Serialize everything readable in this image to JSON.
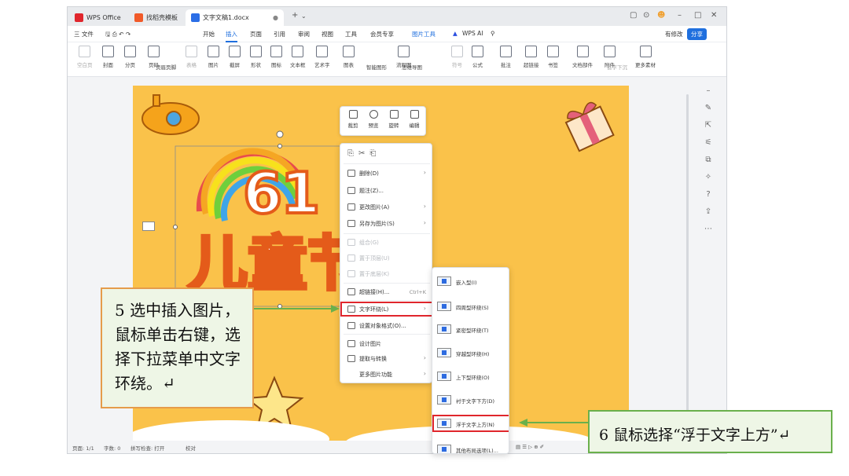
{
  "tabs": [
    {
      "label": "WPS Office"
    },
    {
      "label": "找稻壳模板"
    },
    {
      "label": "文字文稿1.docx"
    }
  ],
  "window": {
    "new_tab": "+",
    "dropdown": "⌄"
  },
  "menubar": {
    "file": "三 文件",
    "items": [
      "开始",
      "插入",
      "页面",
      "引用",
      "审阅",
      "视图",
      "工具",
      "会员专享",
      "图片工具"
    ],
    "wps_ai": "WPS AI",
    "revise": "有修改",
    "share": "分享"
  },
  "ribbon": [
    "空白页",
    "封面",
    "分页",
    "页码",
    "页眉页脚",
    "表格",
    "图片",
    "截屏",
    "形状",
    "图标",
    "文本框",
    "艺术字",
    "图表",
    "流程图",
    "智能图形",
    "思维导图",
    "符号",
    "公式",
    "批注",
    "超链接",
    "书签",
    "文档部件",
    "附件",
    "首字下沉",
    "更多素材"
  ],
  "doc": {
    "art_text_1": "61",
    "art_text_2": "儿童节"
  },
  "mini_toolbar": [
    "裁剪",
    "预览",
    "旋转",
    "编辑"
  ],
  "context_menu": {
    "delete": "删除(D)",
    "caption": "题注(Z)...",
    "change_picture": "更改图片(A)",
    "save_as_picture": "另存为图片(S)",
    "group": "组合(G)",
    "bring_front": "置于顶层(U)",
    "send_back": "置于底层(K)",
    "hyperlink": "超链接(H)...",
    "hyperlink_shortcut": "Ctrl+K",
    "text_wrap": "文字环绕(L)",
    "format_object": "设置对象格式(O)...",
    "design_picture": "设计图片",
    "extract_convert": "提取与转换",
    "more_functions": "更多图片功能"
  },
  "submenu": [
    "嵌入型(I)",
    "四周型环绕(S)",
    "紧密型环绕(T)",
    "穿越型环绕(H)",
    "上下型环绕(O)",
    "衬于文字下方(D)",
    "浮于文字上方(N)",
    "其他布局选项(L)..."
  ],
  "statusbar": {
    "page": "页面: 1/1",
    "words": "字数: 0",
    "spell": "拼写检查: 打开",
    "proof": "校对"
  },
  "callouts": {
    "step5": "5 选中插入图片，鼠标单击右键，选择下拉菜单中文字环绕。↵",
    "step6": "6 鼠标选择“浮于文字上方”↵"
  },
  "colors": {
    "accent": "#1f6fde",
    "doc_bg": "#fac24a",
    "highlight": "#e0262c",
    "arrow": "#6ab04c",
    "callout_border": "#e59c4b"
  }
}
